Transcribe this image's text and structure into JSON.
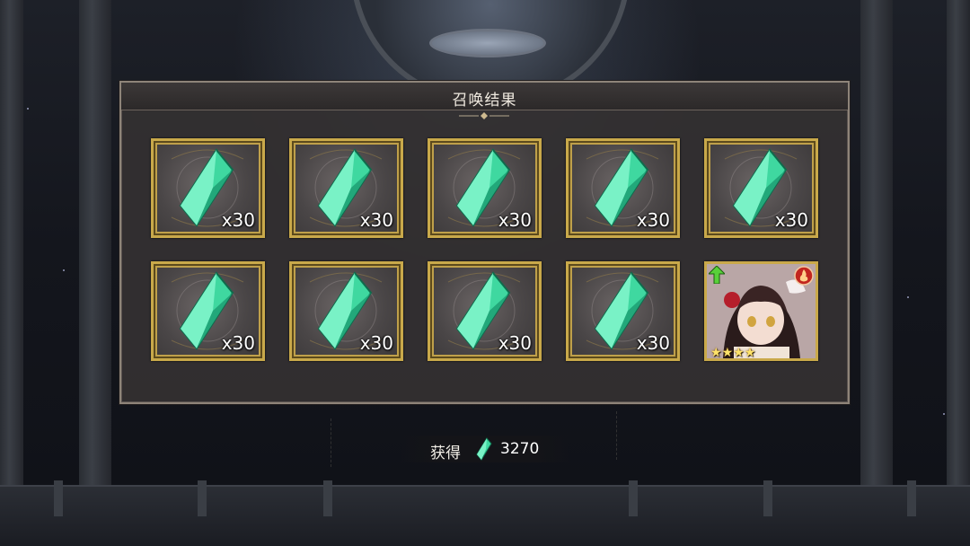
{
  "window": {
    "title": "召唤结果"
  },
  "colors": {
    "panel_bg": "#343031",
    "frame_gold": "#c9a94a",
    "gem_green": "#3fd8a0",
    "text": "#efe9df"
  },
  "results": [
    {
      "type": "gem",
      "icon": "green-crystal-icon",
      "quantity": "x30"
    },
    {
      "type": "gem",
      "icon": "green-crystal-icon",
      "quantity": "x30"
    },
    {
      "type": "gem",
      "icon": "green-crystal-icon",
      "quantity": "x30"
    },
    {
      "type": "gem",
      "icon": "green-crystal-icon",
      "quantity": "x30"
    },
    {
      "type": "gem",
      "icon": "green-crystal-icon",
      "quantity": "x30"
    },
    {
      "type": "gem",
      "icon": "green-crystal-icon",
      "quantity": "x30"
    },
    {
      "type": "gem",
      "icon": "green-crystal-icon",
      "quantity": "x30"
    },
    {
      "type": "gem",
      "icon": "green-crystal-icon",
      "quantity": "x30"
    },
    {
      "type": "gem",
      "icon": "green-crystal-icon",
      "quantity": "x30"
    },
    {
      "type": "character",
      "icon": "character-portrait",
      "rarity_stars": 4,
      "element_icon": "fire-element-icon",
      "badge_icon": "upgrade-arrow-icon"
    }
  ],
  "total": {
    "label": "获得",
    "icon": "green-crystal-icon",
    "value": "3270"
  }
}
